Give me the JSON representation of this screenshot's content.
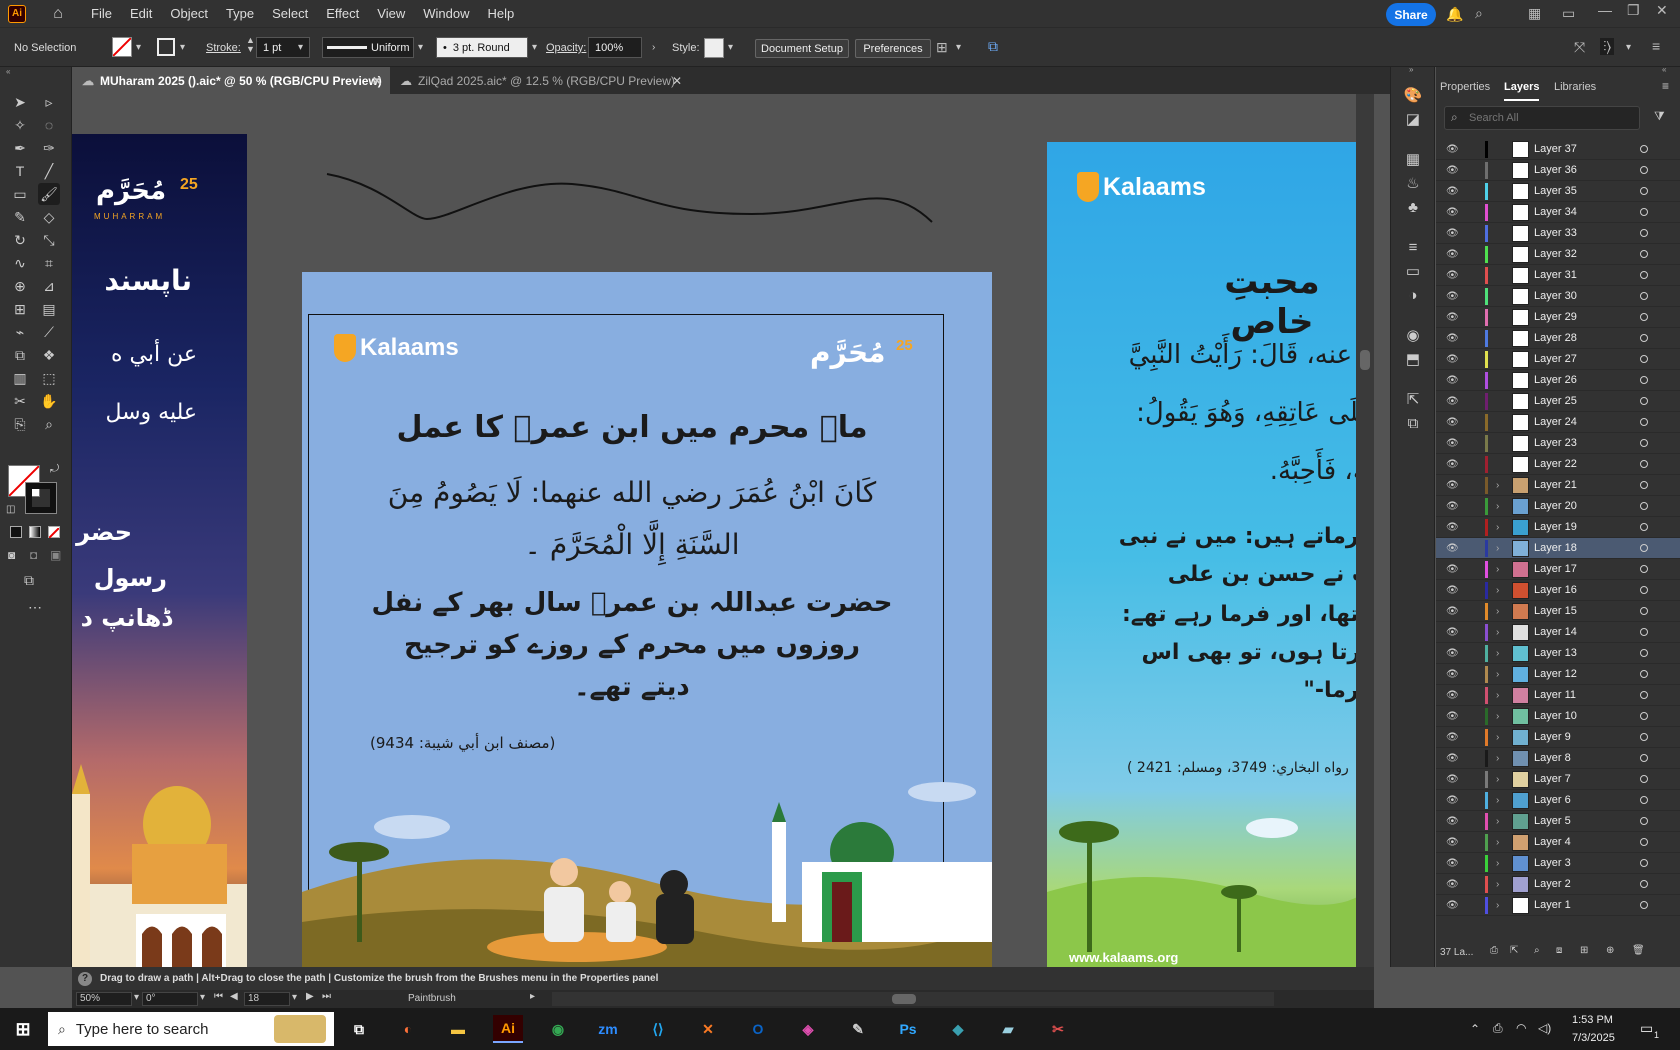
{
  "app": {
    "logo": "Ai"
  },
  "menu": [
    "File",
    "Edit",
    "Object",
    "Type",
    "Select",
    "Effect",
    "View",
    "Window",
    "Help"
  ],
  "share_label": "Share",
  "control": {
    "selection": "No Selection",
    "stroke_label": "Stroke:",
    "stroke_value": "1 pt",
    "stroke_profile": "Uniform",
    "brush": "3 pt. Round",
    "opacity_label": "Opacity:",
    "opacity_value": "100%",
    "style_label": "Style:",
    "document_setup": "Document Setup",
    "preferences": "Preferences"
  },
  "tabs": [
    {
      "label": "MUharam 2025 ().aic* @ 50 % (RGB/CPU Preview)",
      "active": true
    },
    {
      "label": "ZilQad 2025.aic* @ 12.5 % (RGB/CPU Preview)",
      "active": false
    }
  ],
  "artboard_mid": {
    "brand": "Kalaams",
    "muharram_label": "مُحَرَّم",
    "muharram_num": "25",
    "title": "ماہ محرم میں ابن عمرؓ کا عمل",
    "arabic_line1": "كَانَ ابْنُ عُمَرَ رضي الله عنهما: لَا يَصُومُ مِنَ",
    "arabic_line2": "السَّنَةِ إِلَّا الْمُحَرَّمَ ۔",
    "urdu_line1": "حضرت عبداللہ بن عمرؓ سال بھر کے نفل",
    "urdu_line2": "روزوں میں محرم کے روزے کو ترجیح",
    "urdu_line3": "دیتے تھے۔",
    "reference": "(مصنف ابن أبي شيبة: 9434)"
  },
  "artboard_left": {
    "muharram_label": "مُحَرَّم",
    "muharram_en": "MUHARRAM",
    "muharram_num": "25",
    "line1": "ناپسند",
    "line2": "عن أبي ه",
    "line3": "عليه وسل",
    "line4": "حضر",
    "line5": "رسول",
    "line6": "ڈھانپ د"
  },
  "artboard_right": {
    "brand": "Kalaams",
    "title": "محبتِ خاص",
    "line1": "ه عنه، قَالَ: رَأَيْتُ النَّبِيَّ",
    "line2": "عَلَى عَاتِقِهِ، وَهُوَ يَقُولُ:",
    "line3": "بُّهُ، فَأَحِبَّهُ.",
    "line4": "فرماتے ہیں: میں نے نبی",
    "line5": "پ نے حسن بن علی",
    "line6": "ا تھا، اور فرما رہے تھے:",
    "line7": "کرتا ہوں، تو بھی اس",
    "line8": "فرما-\"",
    "reference": "رواه البخاري: 3749، ومسلم: 2421 )",
    "url": "www.kalaams.org"
  },
  "panel_tabs": [
    "Properties",
    "Layers",
    "Libraries"
  ],
  "search_placeholder": "Search All",
  "layers": [
    {
      "name": "Layer 37",
      "color": "#000000",
      "expandable": false,
      "thumb": "#ffffff"
    },
    {
      "name": "Layer 36",
      "color": "#6f6f6f",
      "expandable": false,
      "thumb": "#ffffff"
    },
    {
      "name": "Layer 35",
      "color": "#4fd0e8",
      "expandable": false,
      "thumb": "#ffffff"
    },
    {
      "name": "Layer 34",
      "color": "#e04fd0",
      "expandable": false,
      "thumb": "#ffffff"
    },
    {
      "name": "Layer 33",
      "color": "#4f6fe0",
      "expandable": false,
      "thumb": "#ffffff"
    },
    {
      "name": "Layer 32",
      "color": "#4fe04f",
      "expandable": false,
      "thumb": "#ffffff"
    },
    {
      "name": "Layer 31",
      "color": "#e04f4f",
      "expandable": false,
      "thumb": "#ffffff"
    },
    {
      "name": "Layer 30",
      "color": "#4fe07a",
      "expandable": false,
      "thumb": "#ffffff"
    },
    {
      "name": "Layer 29",
      "color": "#e06fb0",
      "expandable": false,
      "thumb": "#ffffff"
    },
    {
      "name": "Layer 28",
      "color": "#4f7ae0",
      "expandable": false,
      "thumb": "#ffffff"
    },
    {
      "name": "Layer 27",
      "color": "#e0e04f",
      "expandable": false,
      "thumb": "#ffffff"
    },
    {
      "name": "Layer 26",
      "color": "#b04fe0",
      "expandable": false,
      "thumb": "#ffffff"
    },
    {
      "name": "Layer 25",
      "color": "#6f1f6f",
      "expandable": false,
      "thumb": "#ffffff"
    },
    {
      "name": "Layer 24",
      "color": "#8a6a2a",
      "expandable": false,
      "thumb": "#ffffff"
    },
    {
      "name": "Layer 23",
      "color": "#7a7a4a",
      "expandable": false,
      "thumb": "#ffffff"
    },
    {
      "name": "Layer 22",
      "color": "#a02030",
      "expandable": false,
      "thumb": "#ffffff"
    },
    {
      "name": "Layer 21",
      "color": "#7a5a2a",
      "expandable": true,
      "thumb": "#c8a070"
    },
    {
      "name": "Layer 20",
      "color": "#3a9a3a",
      "expandable": true,
      "thumb": "#6aa0d0"
    },
    {
      "name": "Layer 19",
      "color": "#b02020",
      "expandable": true,
      "thumb": "#3aa0d0"
    },
    {
      "name": "Layer 18",
      "color": "#2a3aa0",
      "expandable": true,
      "thumb": "#80b0d8",
      "selected": true
    },
    {
      "name": "Layer 17",
      "color": "#e04fe0",
      "expandable": true,
      "thumb": "#d07090"
    },
    {
      "name": "Layer 16",
      "color": "#2a2aa0",
      "expandable": true,
      "thumb": "#d05030"
    },
    {
      "name": "Layer 15",
      "color": "#e08a2a",
      "expandable": true,
      "thumb": "#d07a50"
    },
    {
      "name": "Layer 14",
      "color": "#8a4fd0",
      "expandable": true,
      "thumb": "#e0e0e0"
    },
    {
      "name": "Layer 13",
      "color": "#4fb0a0",
      "expandable": true,
      "thumb": "#60c0d0"
    },
    {
      "name": "Layer 12",
      "color": "#b08a4f",
      "expandable": true,
      "thumb": "#60b0e0"
    },
    {
      "name": "Layer 11",
      "color": "#d05070",
      "expandable": true,
      "thumb": "#d080a0"
    },
    {
      "name": "Layer 10",
      "color": "#2a6a2a",
      "expandable": true,
      "thumb": "#70c0a0"
    },
    {
      "name": "Layer 9",
      "color": "#e07a2a",
      "expandable": true,
      "thumb": "#70b0d0"
    },
    {
      "name": "Layer 8",
      "color": "#1a1a1a",
      "expandable": true,
      "thumb": "#7090b0"
    },
    {
      "name": "Layer 7",
      "color": "#7a7a7a",
      "expandable": true,
      "thumb": "#e0d0a0"
    },
    {
      "name": "Layer 6",
      "color": "#4fb0e0",
      "expandable": true,
      "thumb": "#4fa0d0"
    },
    {
      "name": "Layer 5",
      "color": "#e04fb0",
      "expandable": true,
      "thumb": "#60a090"
    },
    {
      "name": "Layer 4",
      "color": "#4fa04f",
      "expandable": true,
      "thumb": "#d0a070"
    },
    {
      "name": "Layer 3",
      "color": "#3ad03a",
      "expandable": true,
      "thumb": "#6090d0"
    },
    {
      "name": "Layer 2",
      "color": "#e04f4f",
      "expandable": true,
      "thumb": "#a0a0d0"
    },
    {
      "name": "Layer 1",
      "color": "#4f4fe0",
      "expandable": true,
      "thumb": "#ffffff"
    }
  ],
  "layer_count": "37 La...",
  "status": {
    "hint": "Drag to draw a path  |  Alt+Drag to close the path  |  Customize the brush from the Brushes menu in the Properties panel",
    "zoom": "50%",
    "rotation": "0°",
    "artboard_num": "18",
    "tool": "Paintbrush"
  },
  "taskbar": {
    "search_placeholder": "Type here to search",
    "time": "1:53 PM",
    "date": "7/3/2025",
    "notification_count": "1"
  }
}
